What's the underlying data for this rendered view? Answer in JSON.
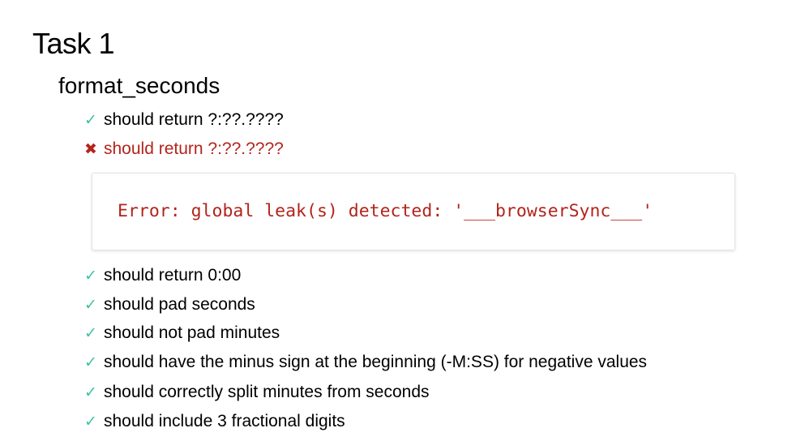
{
  "suite": {
    "title": "Task 1",
    "subsuite": {
      "title": "format_seconds",
      "tests_before": [
        {
          "status": "pass",
          "mark": "✓",
          "label": "should return ?:??.????"
        },
        {
          "status": "fail",
          "mark": "✖",
          "label": "should return ?:??.????"
        }
      ],
      "error": {
        "message": "Error: global leak(s) detected: '___browserSync___'"
      },
      "tests_after": [
        {
          "status": "pass",
          "mark": "✓",
          "label": "should return 0:00"
        },
        {
          "status": "pass",
          "mark": "✓",
          "label": "should pad seconds"
        },
        {
          "status": "pass",
          "mark": "✓",
          "label": "should not pad minutes"
        },
        {
          "status": "pass",
          "mark": "✓",
          "label": "should have the minus sign at the beginning (-M:SS) for negative values"
        },
        {
          "status": "pass",
          "mark": "✓",
          "label": "should correctly split minutes from seconds"
        },
        {
          "status": "pass",
          "mark": "✓",
          "label": "should include 3 fractional digits"
        }
      ]
    }
  },
  "colors": {
    "pass": "#3fc1a3",
    "fail": "#b3241c"
  }
}
